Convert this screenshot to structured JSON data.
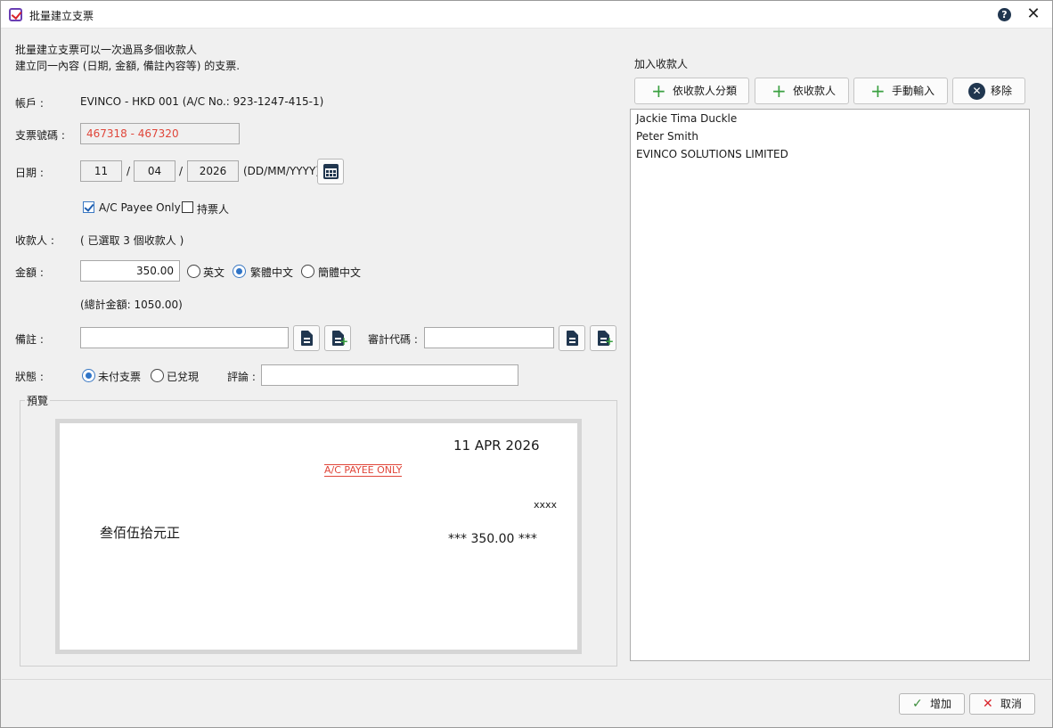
{
  "window": {
    "title": "批量建立支票",
    "help_label": "?",
    "close_label": "✕"
  },
  "intro": {
    "line1": "批量建立支票可以一次過爲多個收款人",
    "line2": "建立同一內容 (日期, 金額, 備註內容等) 的支票."
  },
  "form": {
    "account_label": "帳戶 :",
    "account_value": "EVINCO - HKD 001 (A/C No.: 923-1247-415-1)",
    "cheque_no_label": "支票號碼 :",
    "cheque_no_value": "467318 - 467320",
    "date_label": "日期 :",
    "date_day": "11",
    "date_month": "04",
    "date_year": "2026",
    "date_sep": "/",
    "date_format": "(DD/MM/YYYY)",
    "ac_payee_label": "A/C Payee Only",
    "ac_payee_checked": true,
    "bearer_label": "持票人",
    "bearer_checked": false,
    "payee_label": "收款人 :",
    "payee_value": "( 已選取  3 個收款人 )",
    "amount_label": "金額 :",
    "amount_value": "350.00",
    "lang_english": "英文",
    "lang_trad": "繁體中文",
    "lang_simp": "簡體中文",
    "lang_selected": "繁體中文",
    "total_label": "(總計金額: 1050.00)",
    "remarks_label": "備註 :",
    "remarks_value": "",
    "audit_label": "審計代碼 :",
    "audit_value": "",
    "status_label": "狀態 :",
    "status_unpaid": "未付支票",
    "status_cashed": "已兌現",
    "status_selected": "未付支票",
    "comment_label": "評論 :",
    "comment_value": ""
  },
  "preview": {
    "title": "預覽",
    "date": "11 APR 2026",
    "crossing": "A/C PAYEE ONLY",
    "payee": "xxxx",
    "amount_words": "叁佰伍拾元正",
    "amount_figure": "*** 350.00 ***"
  },
  "payees": {
    "section_title": "加入收款人",
    "btn_by_category": "依收款人分類",
    "btn_by_payee": "依收款人",
    "btn_manual": "手動輸入",
    "btn_remove": "移除",
    "items": [
      "Jackie Tima Duckle",
      "Peter Smith",
      "EVINCO SOLUTIONS LIMITED"
    ]
  },
  "footer": {
    "add_label": "增加",
    "cancel_label": "取消"
  },
  "colors": {
    "accent_red": "#e0463a",
    "icon_navy": "#20364f",
    "plus_green": "#3aa040",
    "radio_blue": "#2f74c7"
  }
}
